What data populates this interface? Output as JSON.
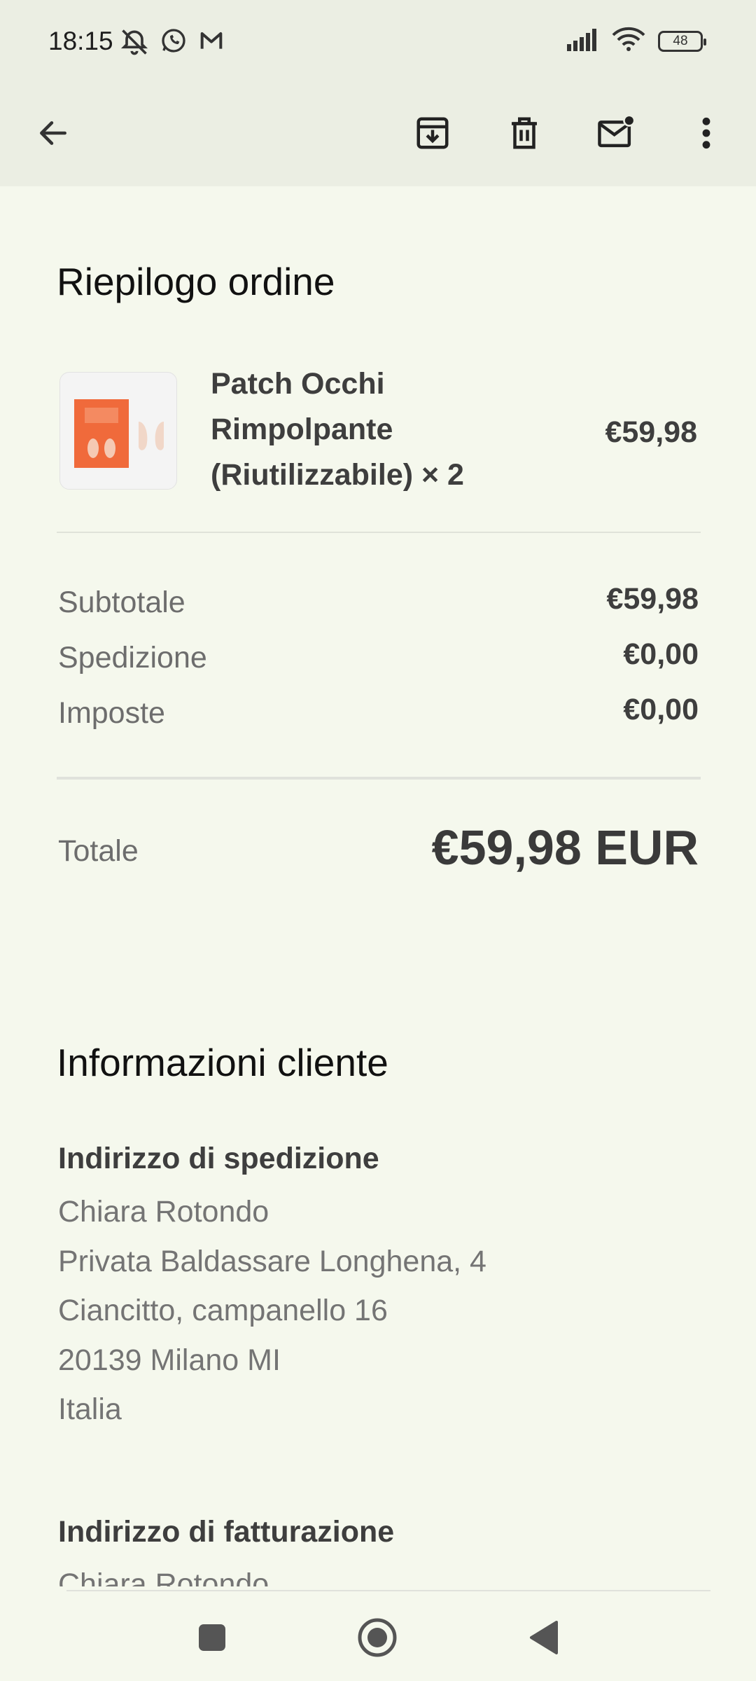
{
  "status_bar": {
    "time": "18:15",
    "battery": "48",
    "left_icons": [
      "alarm-off-icon",
      "whatsapp-icon",
      "gmail-icon"
    ],
    "right_icons": [
      "signal-icon",
      "wifi-icon",
      "battery-icon"
    ]
  },
  "app_bar": {
    "actions": [
      "back-icon",
      "archive-icon",
      "delete-icon",
      "mark-unread-icon",
      "more-options-icon"
    ]
  },
  "order_summary": {
    "title": "Riepilogo ordine",
    "product": {
      "name": "Patch Occhi Rimpolpante (Riutilizzabile) × 2",
      "price": "€59,98"
    },
    "rows": [
      {
        "label": "Subtotale",
        "value": "€59,98"
      },
      {
        "label": "Spedizione",
        "value": "€0,00"
      },
      {
        "label": "Imposte",
        "value": "€0,00"
      }
    ],
    "total_label": "Totale",
    "total_value": "€59,98 EUR"
  },
  "customer_info": {
    "title": "Informazioni cliente",
    "shipping": {
      "title": "Indirizzo di spedizione",
      "lines": [
        "Chiara Rotondo",
        "Privata Baldassare Longhena, 4",
        "Ciancitto, campanello 16",
        "20139 Milano MI",
        "Italia"
      ]
    },
    "billing": {
      "title": "Indirizzo di fatturazione",
      "lines": [
        "Chiara Rotondo"
      ]
    }
  },
  "colors": {
    "background": "#f5f8ed",
    "bar": "#ebeee3",
    "product_orange": "#f06a3b"
  }
}
